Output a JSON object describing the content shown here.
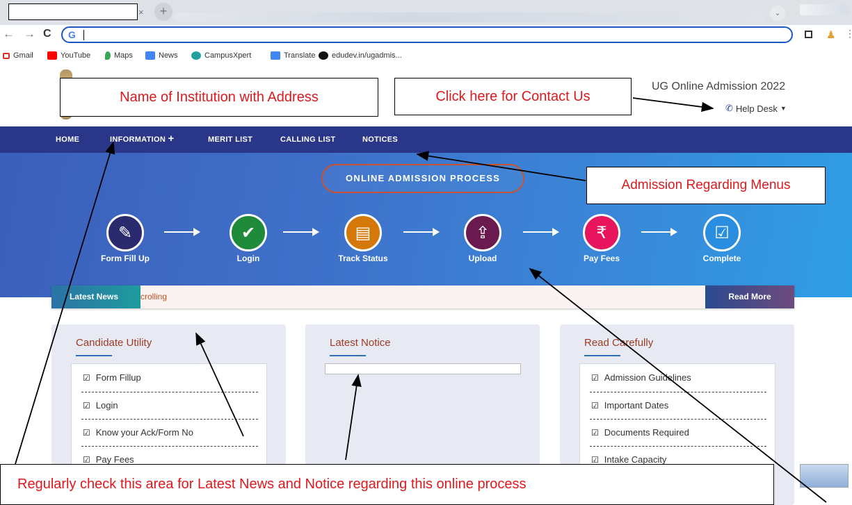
{
  "browser": {
    "tab_close": "×",
    "new_tab": "+",
    "back": "←",
    "forward": "→",
    "reload": "C",
    "omnibox_icon": "G",
    "bookmarks": [
      {
        "label": "Gmail",
        "color": "#d93025"
      },
      {
        "label": "YouTube",
        "color": "#ff0000"
      },
      {
        "label": "Maps",
        "color": "#34a853"
      },
      {
        "label": "News",
        "color": "#4285f4"
      },
      {
        "label": "CampusXpert",
        "color": "#21a0a0"
      },
      {
        "label": "Translate",
        "color": "#4285f4"
      },
      {
        "label": "edudev.in/ugadmis...",
        "color": "#111111"
      }
    ]
  },
  "header": {
    "title": "UG Online Admission 2022",
    "help_desk": "Help Desk"
  },
  "nav": {
    "items": [
      "HOME",
      "INFORMATION",
      "MERIT LIST",
      "CALLING LIST",
      "NOTICES"
    ],
    "information_plus": "+"
  },
  "hero": {
    "title": "ONLINE ADMISSION PROCESS",
    "steps": [
      {
        "label": "Form Fill Up",
        "icon": "form-icon",
        "color": "#2a2a6e",
        "glyph": "✎"
      },
      {
        "label": "Login",
        "icon": "user-check-icon",
        "color": "#1f8a3a",
        "glyph": "✔"
      },
      {
        "label": "Track Status",
        "icon": "clipboard-icon",
        "color": "#d4780a",
        "glyph": "▤"
      },
      {
        "label": "Upload",
        "icon": "upload-doc-icon",
        "color": "#6a1a4e",
        "glyph": "⇪"
      },
      {
        "label": "Pay Fees",
        "icon": "rupee-icon",
        "color": "#e8155e",
        "glyph": "₹"
      },
      {
        "label": "Complete",
        "icon": "check-complete-icon",
        "color": "#2a8ee0",
        "glyph": "☑"
      }
    ]
  },
  "news": {
    "label": "Latest News",
    "text": "crolling",
    "button": "Read More"
  },
  "cards": {
    "utility": {
      "title": "Candidate Utility",
      "items": [
        "Form Fillup",
        "Login",
        "Know your Ack/Form No",
        "Pay Fees"
      ]
    },
    "notice": {
      "title": "Latest Notice"
    },
    "read": {
      "title": "Read Carefully",
      "items": [
        "Admission Guidelines",
        "Important Dates",
        "Documents Required",
        "Intake Capacity"
      ]
    }
  },
  "annotations": {
    "institution": "Name of Institution with Address",
    "contact": "Click here for Contact Us",
    "menus": "Admission Regarding Menus",
    "news_notice": "Regularly check this area for Latest News and Notice regarding this online process"
  },
  "check_glyph": "☑"
}
